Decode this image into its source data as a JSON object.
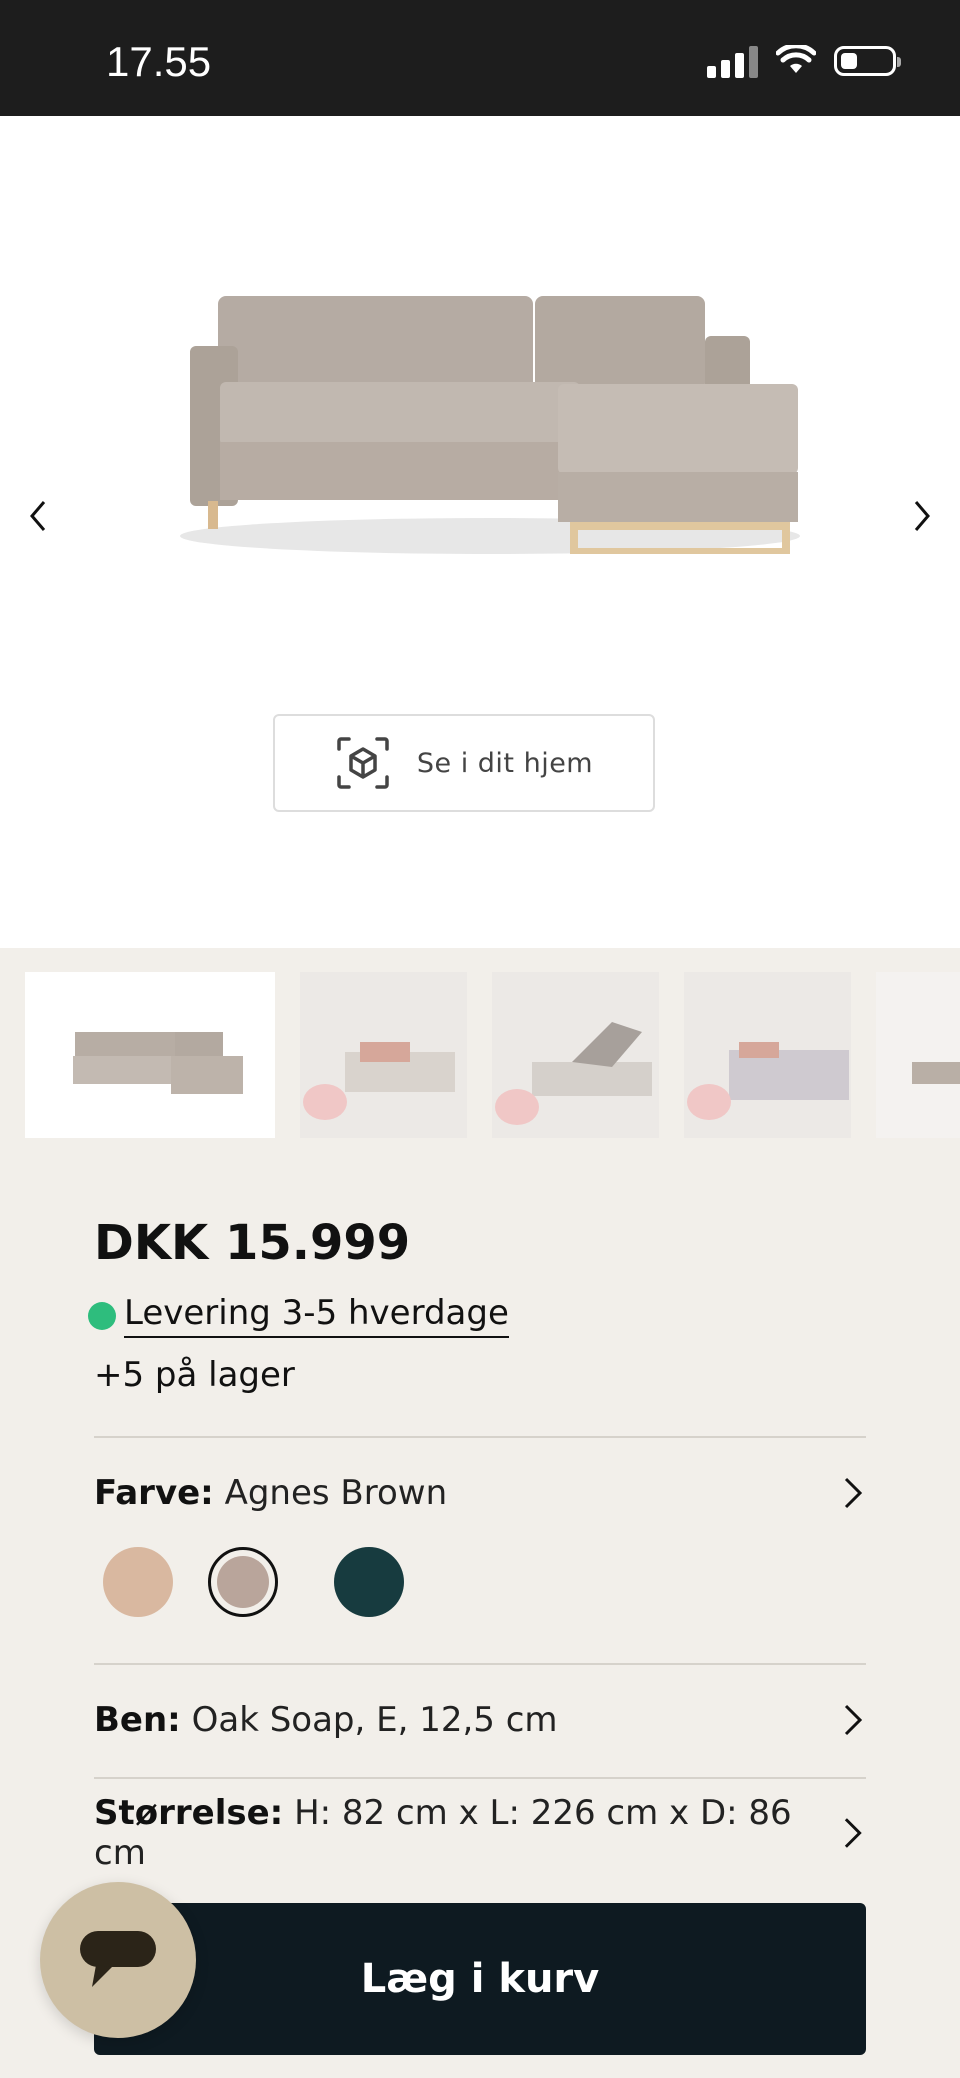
{
  "status_bar": {
    "time": "17.55"
  },
  "hero": {
    "ar_button_label": "Se i dit hjem"
  },
  "thumbnails": [
    "sofa-product",
    "living-room-1",
    "living-room-storage",
    "living-room-bed",
    "sofa-partial"
  ],
  "product": {
    "price": "DKK 15.999",
    "delivery": "Levering 3-5 hverdage",
    "delivery_color": "#2ebd7d",
    "stock": "+5 på lager"
  },
  "options": {
    "color": {
      "label": "Farve:",
      "value": "Agnes Brown"
    },
    "swatches": [
      {
        "name": "beige",
        "color": "#d9b8a0"
      },
      {
        "name": "agnes-brown",
        "color": "#b9a59b",
        "selected": true
      },
      {
        "name": "dark-teal",
        "color": "#173b3f"
      }
    ],
    "legs": {
      "label": "Ben:",
      "value": "Oak Soap, E, 12,5 cm"
    },
    "size": {
      "label": "Størrelse:",
      "value": "H: 82 cm x L: 226 cm x D: 86 cm"
    }
  },
  "cta": {
    "label": "Læg i kurv",
    "color": "#0e1a21"
  }
}
